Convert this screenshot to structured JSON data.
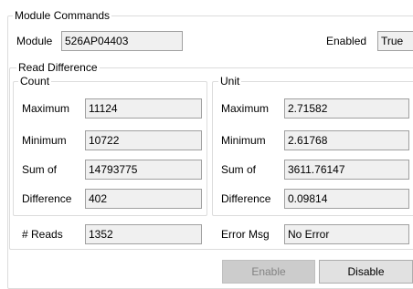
{
  "module_commands": {
    "title": "Module Commands",
    "module_label": "Module",
    "module_value": "526AP04403",
    "enabled_label": "Enabled",
    "enabled_value": "True"
  },
  "read_difference": {
    "title": "Read Difference",
    "count": {
      "title": "Count",
      "maximum_label": "Maximum",
      "maximum_value": "11124",
      "minimum_label": "Minimum",
      "minimum_value": "10722",
      "sum_label": "Sum of",
      "sum_value": "14793775",
      "difference_label": "Difference",
      "difference_value": "402"
    },
    "unit": {
      "title": "Unit",
      "maximum_label": "Maximum",
      "maximum_value": "2.71582",
      "minimum_label": "Minimum",
      "minimum_value": "2.61768",
      "sum_label": "Sum of",
      "sum_value": "3611.76147",
      "difference_label": "Difference",
      "difference_value": "0.09814"
    },
    "reads_label": "# Reads",
    "reads_value": "1352",
    "error_label": "Error Msg",
    "error_value": "No Error"
  },
  "buttons": {
    "enable_label": "Enable",
    "disable_label": "Disable"
  }
}
